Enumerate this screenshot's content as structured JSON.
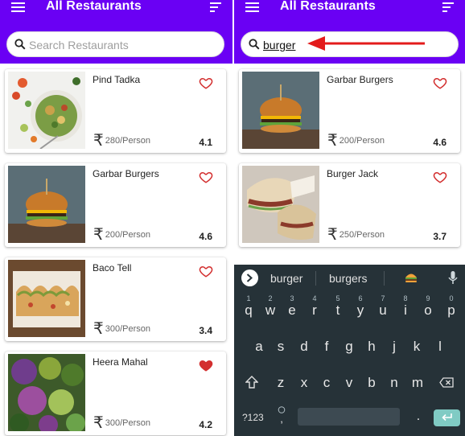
{
  "app": {
    "title": "All Restaurants",
    "accent_color": "#6a00f4",
    "heart_color": "#d32f2f"
  },
  "left": {
    "search": {
      "placeholder": "Search Restaurants",
      "value": ""
    },
    "restaurants": [
      {
        "name": "Pind Tadka",
        "price": "280/Person",
        "rating": "4.1",
        "favorite": false
      },
      {
        "name": "Garbar Burgers",
        "price": "200/Person",
        "rating": "4.6",
        "favorite": false
      },
      {
        "name": "Baco Tell",
        "price": "300/Person",
        "rating": "3.4",
        "favorite": false
      },
      {
        "name": "Heera Mahal",
        "price": "300/Person",
        "rating": "4.2",
        "favorite": true
      }
    ]
  },
  "right": {
    "search": {
      "placeholder": "Search Restaurants",
      "value": "burger"
    },
    "restaurants": [
      {
        "name": "Garbar Burgers",
        "price": "200/Person",
        "rating": "4.6",
        "favorite": false
      },
      {
        "name": "Burger Jack",
        "price": "250/Person",
        "rating": "3.7",
        "favorite": false
      }
    ]
  },
  "currency_symbol": "₹",
  "keyboard": {
    "suggestions": [
      "burger",
      "burgers"
    ],
    "row1": [
      "q",
      "w",
      "e",
      "r",
      "t",
      "y",
      "u",
      "i",
      "o",
      "p"
    ],
    "row1_hints": [
      "1",
      "2",
      "3",
      "4",
      "5",
      "6",
      "7",
      "8",
      "9",
      "0"
    ],
    "row2": [
      "a",
      "s",
      "d",
      "f",
      "g",
      "h",
      "j",
      "k",
      "l"
    ],
    "row3": [
      "z",
      "x",
      "c",
      "v",
      "b",
      "n",
      "m"
    ],
    "symbols_label": "?123",
    "comma": ",",
    "period": "."
  }
}
